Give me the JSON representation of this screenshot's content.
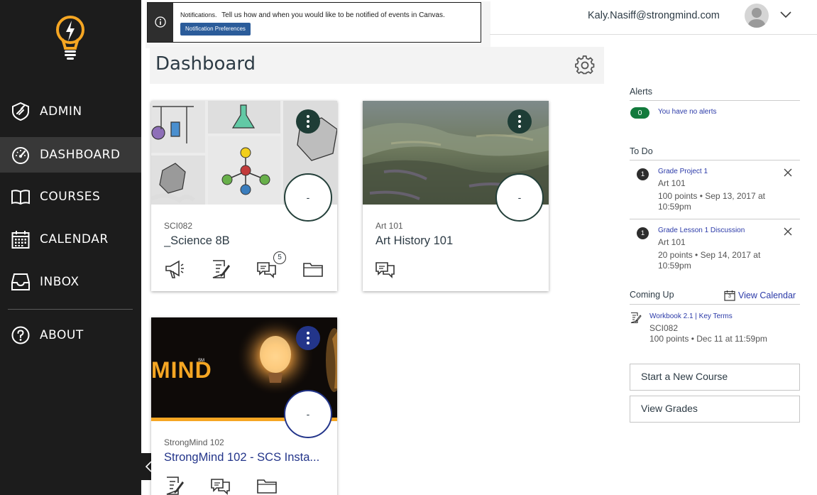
{
  "sidebar": {
    "items": [
      {
        "label": "ADMIN",
        "icon": "shield-icon",
        "active": false
      },
      {
        "label": "DASHBOARD",
        "icon": "speedometer-icon",
        "active": true
      },
      {
        "label": "COURSES",
        "icon": "book-icon",
        "active": false
      },
      {
        "label": "CALENDAR",
        "icon": "calendar-icon",
        "active": false
      },
      {
        "label": "INBOX",
        "icon": "inbox-icon",
        "active": false
      },
      {
        "label": "ABOUT",
        "icon": "help-icon",
        "active": false
      }
    ]
  },
  "notification": {
    "title": "Notifications.",
    "message": "Tell us how and when you would like to be notified of events in Canvas.",
    "button_label": "Notification Preferences"
  },
  "header": {
    "user_email": "Kaly.Nasiff@strongmind.com"
  },
  "dashboard": {
    "title": "Dashboard"
  },
  "cards": [
    {
      "code": "SCI082",
      "name": "_Science 8B",
      "grade": "-",
      "kebab_color": "#1e3d36",
      "discussion_badge": "5"
    },
    {
      "code": "Art 101",
      "name": "Art History 101",
      "grade": "-",
      "kebab_color": "#1e3d36"
    },
    {
      "code": "StrongMind 102",
      "name": "StrongMind 102 - SCS Insta...",
      "grade": "-",
      "kebab_color": "#23358a",
      "image_text": "MIND",
      "image_mark": "SM"
    }
  ],
  "alerts": {
    "heading": "Alerts",
    "count": "0",
    "message": "You have no alerts"
  },
  "todo": {
    "heading": "To Do",
    "items": [
      {
        "count": "1",
        "title": "Grade Project 1",
        "course": "Art 101",
        "meta": "100 points • Sep 13, 2017 at 10:59pm"
      },
      {
        "count": "1",
        "title": "Grade Lesson 1 Discussion",
        "course": "Art 101",
        "meta": "20 points • Sep 14, 2017 at 10:59pm"
      }
    ]
  },
  "coming_up": {
    "heading": "Coming Up",
    "view_calendar_label": "View Calendar",
    "calendar_day": "3",
    "items": [
      {
        "title": "Workbook 2.1 | Key Terms",
        "course": "SCI082",
        "meta": "100 points • Dec 11 at 11:59pm"
      }
    ]
  },
  "actions": {
    "start_course_label": "Start a New Course",
    "view_grades_label": "View Grades"
  }
}
